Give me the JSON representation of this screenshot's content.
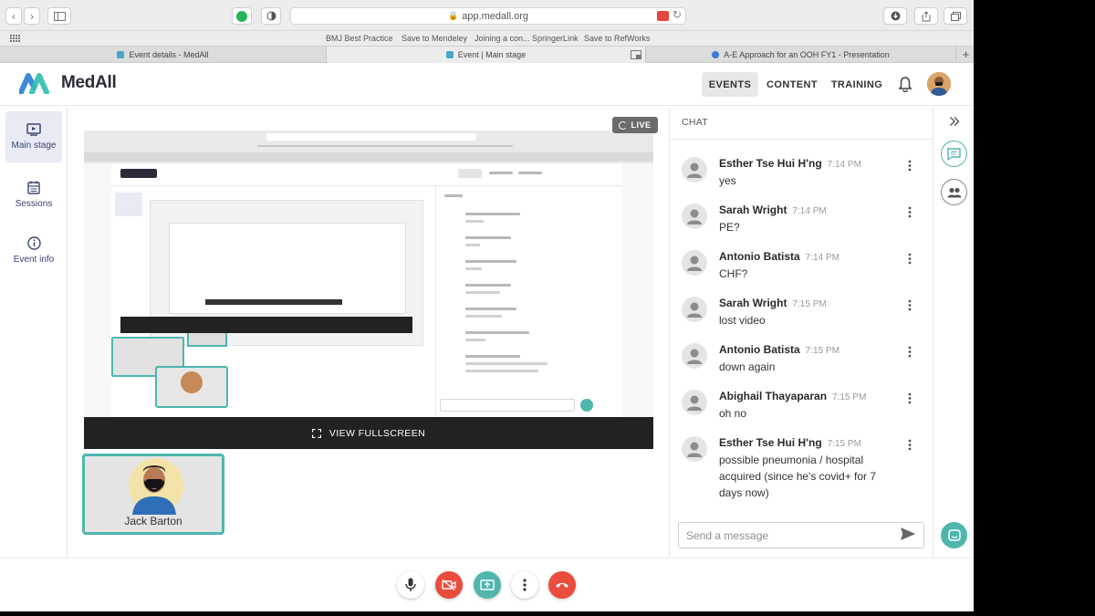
{
  "browser": {
    "url": "app.medall.org",
    "bookmarks": [
      "BMJ Best Practice",
      "Save to Mendeley",
      "Joining a con... SpringerLink",
      "Save to RefWorks"
    ],
    "tabs": [
      {
        "label": "Event details - MedAll",
        "active": false
      },
      {
        "label": "Event | Main stage",
        "active": true
      },
      {
        "label": "A-E Approach for an OOH FY1 - Presentation",
        "active": false
      }
    ]
  },
  "app": {
    "brand": "MedAll",
    "nav": {
      "events": "EVENTS",
      "content": "CONTENT",
      "training": "TRAINING"
    }
  },
  "sidebar": {
    "items": [
      {
        "label": "Main stage",
        "icon": "tv-icon"
      },
      {
        "label": "Sessions",
        "icon": "calendar-icon"
      },
      {
        "label": "Event info",
        "icon": "info-icon"
      }
    ]
  },
  "stage": {
    "live_label": "LIVE",
    "fullscreen_label": "VIEW FULLSCREEN",
    "participant_name": "Jack Barton"
  },
  "chat": {
    "title": "CHAT",
    "messages": [
      {
        "author": "Esther Tse Hui H'ng",
        "time": "7:14 PM",
        "text": "yes"
      },
      {
        "author": "Sarah Wright",
        "time": "7:14 PM",
        "text": "PE?"
      },
      {
        "author": "Antonio Batista",
        "time": "7:14 PM",
        "text": "CHF?"
      },
      {
        "author": "Sarah Wright",
        "time": "7:15 PM",
        "text": "lost video"
      },
      {
        "author": "Antonio Batista",
        "time": "7:15 PM",
        "text": "down again"
      },
      {
        "author": "Abighail Thayaparan",
        "time": "7:15 PM",
        "text": "oh no"
      },
      {
        "author": "Esther Tse Hui H'ng",
        "time": "7:15 PM",
        "text": "possible pneumonia / hospital acquired (since he's covid+ for 7 days now)"
      }
    ],
    "input_placeholder": "Send a message"
  },
  "colors": {
    "accent": "#4fb6ae",
    "danger": "#ea4c3d",
    "brand_dark": "#2b2b3a"
  }
}
